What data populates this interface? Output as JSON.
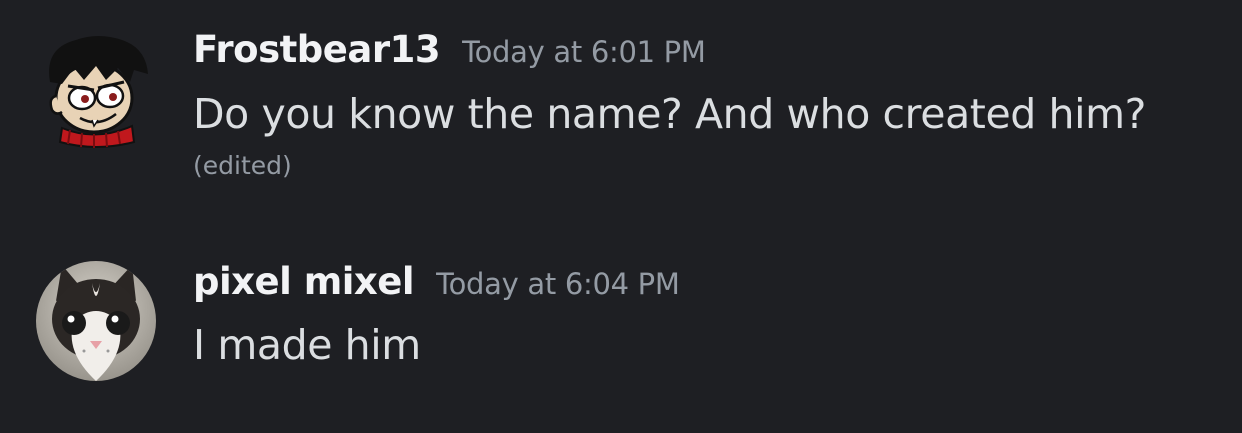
{
  "messages": [
    {
      "username": "Frostbear13",
      "timestamp": "Today at 6:01 PM",
      "content": "Do you know the name? And who created him?",
      "edited_label": "(edited)",
      "avatar_icon": "cartoon-character-avatar"
    },
    {
      "username": "pixel mixel",
      "timestamp": "Today at 6:04 PM",
      "content": "I made him",
      "avatar_icon": "kitten-photo-avatar"
    }
  ],
  "colors": {
    "background": "#1e1f23",
    "username": "#f2f3f5",
    "timestamp": "#949ba4",
    "message_text": "#dbdee1"
  }
}
